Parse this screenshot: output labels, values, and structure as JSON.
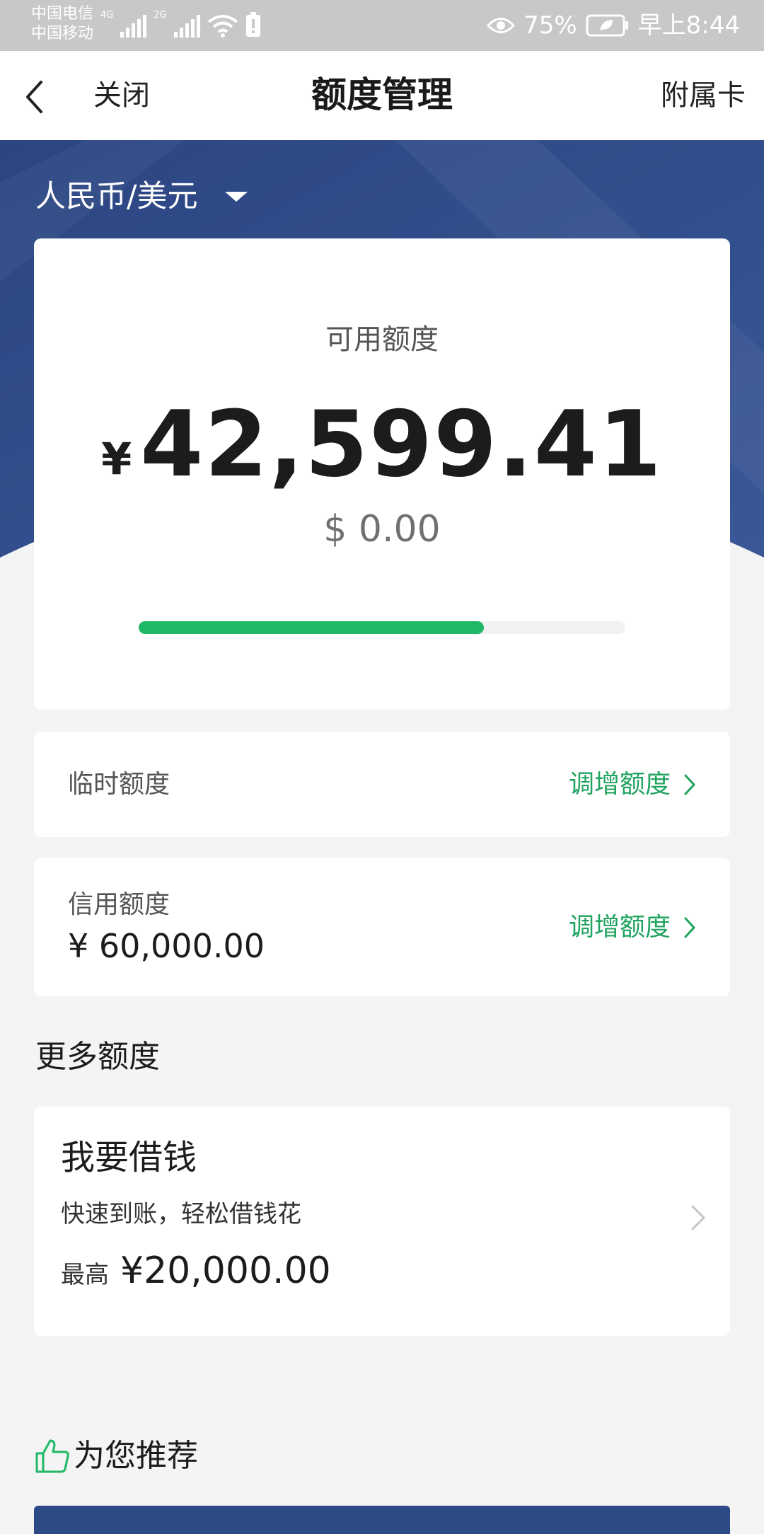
{
  "status_bar": {
    "carrier_1": "中国电信",
    "carrier_2": "中国移动",
    "net_1": "4G",
    "net_2": "2G",
    "battery": "75%",
    "time": "早上8:44"
  },
  "nav": {
    "close_label": "关闭",
    "title": "额度管理",
    "right_label": "附属卡"
  },
  "currency_selector": {
    "label": "人民币/美元"
  },
  "available": {
    "label": "可用额度",
    "cny_symbol": "¥",
    "cny_value": "42,599.41",
    "usd_display": "$ 0.00",
    "used_fraction": 0.71
  },
  "temporary_limit": {
    "label": "临时额度",
    "action": "调增额度"
  },
  "credit_limit": {
    "label": "信用额度",
    "value": "¥ 60,000.00",
    "action": "调增额度"
  },
  "more_limits": {
    "heading": "更多额度"
  },
  "loan": {
    "title": "我要借钱",
    "subtitle": "快速到账，轻松借钱花",
    "max_label": "最高",
    "max_value": "¥20,000.00"
  },
  "recommend": {
    "heading": "为您推荐"
  },
  "colors": {
    "brand_navy": "#2c4a86",
    "accent_green": "#1eb866",
    "action_green": "#1fa35f",
    "page_bg": "#f4f4f4"
  }
}
